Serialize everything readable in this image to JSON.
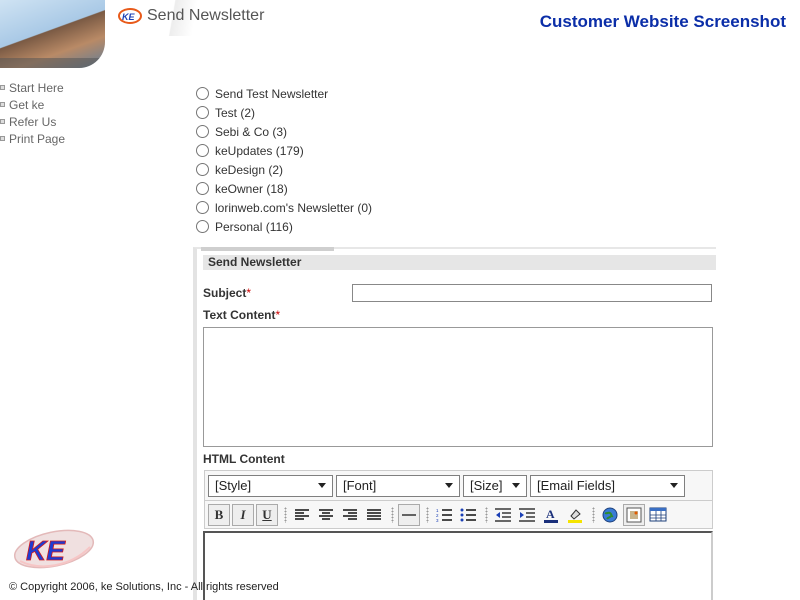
{
  "header": {
    "page_heading": "Send Newsletter",
    "site_title": "Customer Website Screenshot"
  },
  "nav": {
    "items": [
      {
        "label": "Start Here"
      },
      {
        "label": "Get ke"
      },
      {
        "label": "Refer Us"
      },
      {
        "label": "Print Page"
      }
    ]
  },
  "lists": {
    "options": [
      {
        "label": "Send Test Newsletter"
      },
      {
        "label": "Test (2)"
      },
      {
        "label": "Sebi & Co (3)"
      },
      {
        "label": "keUpdates (179)"
      },
      {
        "label": "keDesign (2)"
      },
      {
        "label": "keOwner (18)"
      },
      {
        "label": "lorinweb.com's Newsletter (0)"
      },
      {
        "label": "Personal (116)"
      }
    ]
  },
  "form": {
    "title": "Send Newsletter",
    "subject_label": "Subject",
    "text_content_label": "Text Content",
    "html_content_label": "HTML Content",
    "required_mark": "*",
    "subject_value": "",
    "text_value": ""
  },
  "toolbar": {
    "style": "[Style]",
    "font": "[Font]",
    "size": "[Size]",
    "email_fields": "[Email Fields]",
    "bold": "B",
    "italic": "I",
    "underline": "U"
  },
  "colors": {
    "site_title": "#0b2ea8",
    "required": "#cc0000"
  },
  "footer": {
    "copyright": "© Copyright 2006, ke Solutions, Inc - All rights reserved"
  }
}
